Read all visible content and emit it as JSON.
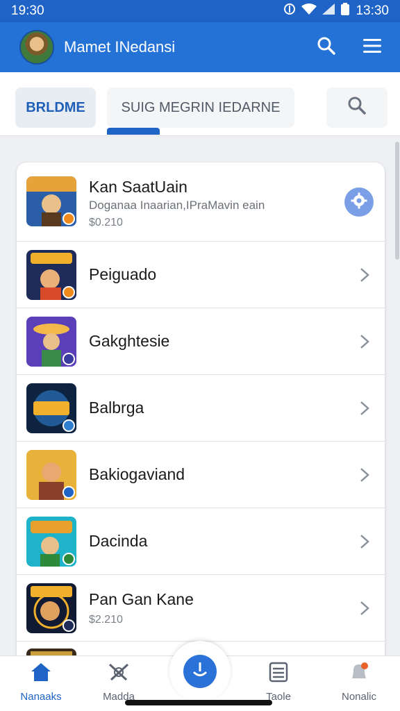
{
  "status_bar": {
    "time_left": "19:30",
    "time_right": "13:30"
  },
  "app_bar": {
    "title": "Mamet INedansi",
    "avatar_icon": "avatar-icon",
    "search_icon": "search-icon",
    "menu_icon": "hamburger-menu-icon"
  },
  "tabs": [
    {
      "label": "BRLDME",
      "active": false
    },
    {
      "label": "SUIG MEGRIN IEDARNE",
      "active": true
    }
  ],
  "tabs_search_icon": "search-icon",
  "list": [
    {
      "title": "Kan SaatUain",
      "subtitle": "Doganaa Inaarian,IPraMavin eain",
      "price": "$0.210",
      "icon_colors": [
        "#2a5fa8",
        "#e5a33a"
      ],
      "action_icon": "settings-icon"
    },
    {
      "title": "Peiguado",
      "icon_colors": [
        "#1f2c5a",
        "#d94a2a"
      ]
    },
    {
      "title": "Gakghtesie",
      "icon_colors": [
        "#5b3fb8",
        "#f2b84a"
      ]
    },
    {
      "title": "Balbrga",
      "icon_colors": [
        "#0d2340",
        "#2f7fd0"
      ]
    },
    {
      "title": "Bakiogaviand",
      "icon_colors": [
        "#e7b13a",
        "#8a3f2b"
      ]
    },
    {
      "title": "Dacinda",
      "icon_colors": [
        "#1fb3c9",
        "#e7a02c"
      ]
    },
    {
      "title": "Pan Gan Kane",
      "price": "$2.210",
      "icon_colors": [
        "#101a33",
        "#f0b02c"
      ]
    }
  ],
  "bottom_nav": [
    {
      "label": "Nanaaks",
      "icon": "home-icon"
    },
    {
      "label": "Madda",
      "icon": "swords-icon"
    },
    {
      "label": "",
      "icon": "download-icon"
    },
    {
      "label": "Taole",
      "icon": "list-icon"
    },
    {
      "label": "Nonalic",
      "icon": "bell-icon"
    }
  ],
  "colors": {
    "primary": "#2472d6",
    "status_bar": "#1f63c6",
    "accent_fab": "#7b9fe6"
  }
}
